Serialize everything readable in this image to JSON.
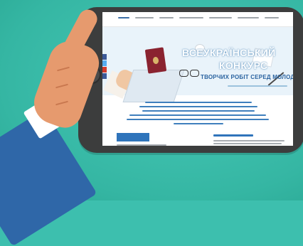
{
  "hero": {
    "title_line1": "ВСЕУКРАЇНСЬКИЙ",
    "title_line2": "КОНКУРС",
    "subtitle": "ТВОРЧИХ РОБІТ СЕРЕД МОЛОДІ"
  },
  "colors": {
    "background": "#3dbfae",
    "phone_body": "#3c3d3d",
    "jacket": "#2f67a8",
    "hand": "#e69a6e",
    "hero_text": "#2a63a0",
    "passport": "#8a2330"
  },
  "social": [
    "#3b5998",
    "#55acee",
    "#d23a2a",
    "#3b5998"
  ]
}
